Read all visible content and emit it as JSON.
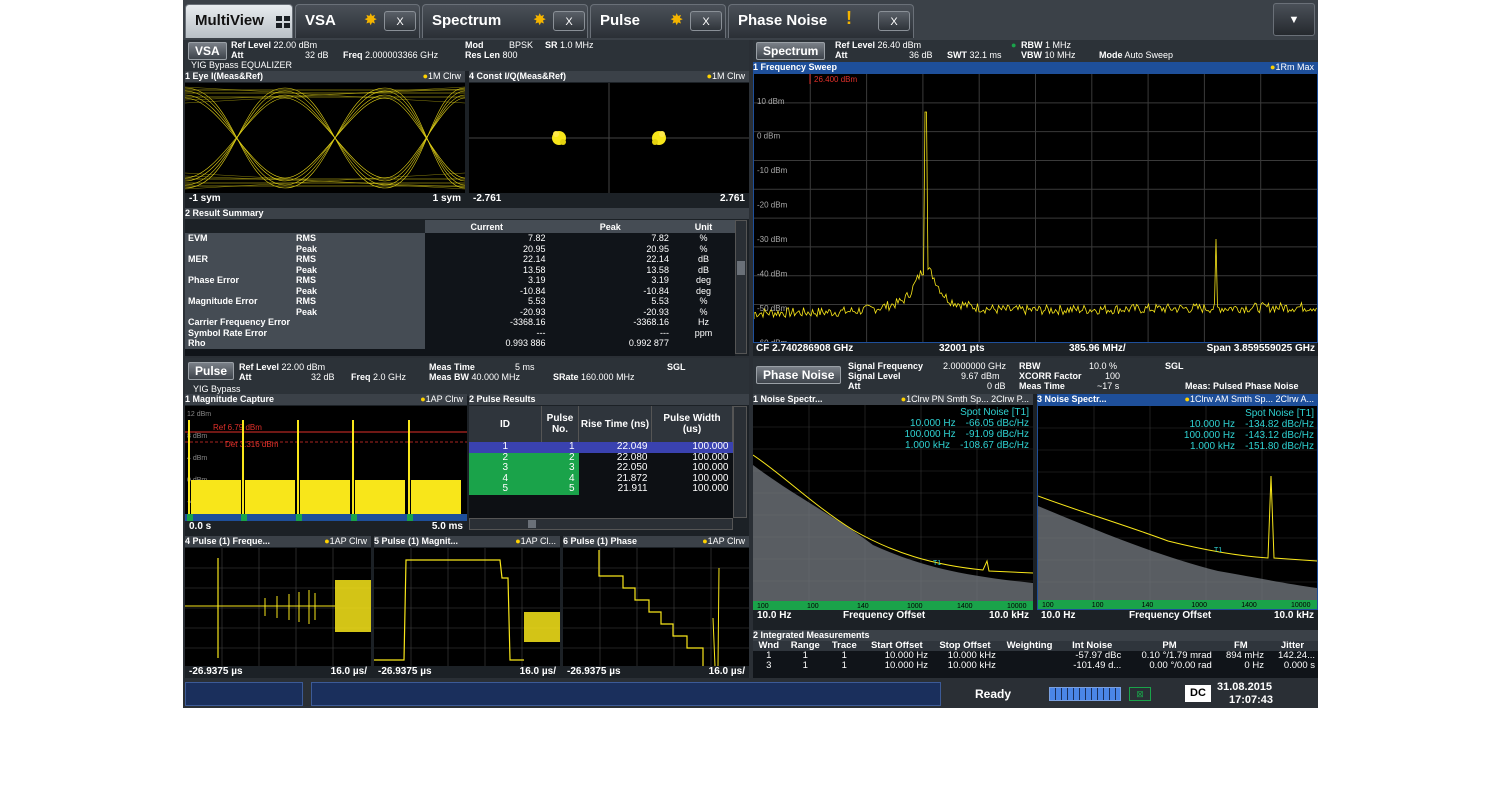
{
  "tabs": [
    {
      "label": "MultiView",
      "active": true
    },
    {
      "label": "VSA",
      "close": "X"
    },
    {
      "label": "Spectrum",
      "close": "X"
    },
    {
      "label": "Pulse",
      "close": "X"
    },
    {
      "label": "Phase Noise",
      "close": "X"
    }
  ],
  "menu_icon": "▼",
  "vsa": {
    "label": "VSA",
    "ref_level_label": "Ref Level",
    "ref_level": "22.00 dBm",
    "att_label": "Att",
    "att": "32 dB",
    "freq_label": "Freq",
    "freq": "2.000003366 GHz",
    "mod_label": "Mod",
    "mod": "BPSK",
    "sr_label": "SR",
    "sr": "1.0 MHz",
    "reslen_label": "Res Len",
    "reslen": "800",
    "bypass": "YIG Bypass EQUALIZER",
    "eye_title": "1 Eye I(Meas&Ref)",
    "eye_trace": "1M Clrw",
    "eye_xmin": "-1 sym",
    "eye_xmax": "1 sym",
    "const_title": "4 Const I/Q(Meas&Ref)",
    "const_trace": "1M Clrw",
    "const_xmin": "-2.761",
    "const_xmax": "2.761",
    "summary_title": "2 Result Summary",
    "summary_headers": [
      "Current",
      "Peak",
      "Unit"
    ],
    "summary_rows": [
      [
        "EVM",
        "RMS",
        "7.82",
        "7.82",
        "%"
      ],
      [
        "",
        "Peak",
        "20.95",
        "20.95",
        "%"
      ],
      [
        "MER",
        "RMS",
        "22.14",
        "22.14",
        "dB"
      ],
      [
        "",
        "Peak",
        "13.58",
        "13.58",
        "dB"
      ],
      [
        "Phase Error",
        "RMS",
        "3.19",
        "3.19",
        "deg"
      ],
      [
        "",
        "Peak",
        "-10.84",
        "-10.84",
        "deg"
      ],
      [
        "Magnitude Error",
        "RMS",
        "5.53",
        "5.53",
        "%"
      ],
      [
        "",
        "Peak",
        "-20.93",
        "-20.93",
        "%"
      ],
      [
        "Carrier Frequency Error",
        "",
        "-3368.16",
        "-3368.16",
        "Hz"
      ],
      [
        "Symbol Rate Error",
        "",
        "---",
        "---",
        "ppm"
      ],
      [
        "Rho",
        "",
        "0.993 886",
        "0.992 877",
        ""
      ]
    ]
  },
  "spectrum": {
    "label": "Spectrum",
    "ref_level_label": "Ref Level",
    "ref_level": "26.40 dBm",
    "att_label": "Att",
    "att": "36 dB",
    "swt_label": "SWT",
    "swt": "32.1 ms",
    "rbw_label": "RBW",
    "rbw": "1 MHz",
    "vbw_label": "VBW",
    "vbw": "10 MHz",
    "mode_label": "Mode",
    "mode": "Auto Sweep",
    "title": "1 Frequency Sweep",
    "trace": "1Rm Max",
    "marker_ref": "26.400 dBm",
    "yticks": [
      "10 dBm",
      "0 dBm",
      "-10 dBm",
      "-20 dBm",
      "-30 dBm",
      "-40 dBm",
      "-50 dBm",
      "-60 dBm"
    ],
    "cf": "CF 2.740286908 GHz",
    "pts": "32001 pts",
    "div": "385.96 MHz/",
    "span": "Span 3.859559025 GHz"
  },
  "pulse": {
    "label": "Pulse",
    "ref_level_label": "Ref Level",
    "ref_level": "22.00 dBm",
    "att_label": "Att",
    "att": "32 dB",
    "freq_label": "Freq",
    "freq": "2.0 GHz",
    "meastime_label": "Meas Time",
    "meastime": "5 ms",
    "measbw_label": "Meas BW",
    "measbw": "40.000 MHz",
    "srate_label": "SRate",
    "srate": "160.000 MHz",
    "sgl": "SGL",
    "bypass": "YIG Bypass",
    "mag_title": "1 Magnitude Capture",
    "mag_trace": "1AP Clrw",
    "mag_ref": "Ref 6.79 dBm",
    "mag_det": "Det 3.316 dBm",
    "mag_yticks": [
      "12 dBm",
      "8 dBm",
      "4 dBm",
      "0 dBm",
      "-4 dBm"
    ],
    "mag_xmin": "0.0 s",
    "mag_xmax": "5.0 ms",
    "results_title": "2 Pulse Results",
    "results_headers": [
      "ID",
      "Pulse No.",
      "Rise Time (ns)",
      "Pulse Width (us)"
    ],
    "results_rows": [
      [
        "1",
        "1",
        "22.049",
        "100.000"
      ],
      [
        "2",
        "2",
        "22.080",
        "100.000"
      ],
      [
        "3",
        "3",
        "22.050",
        "100.000"
      ],
      [
        "4",
        "4",
        "21.872",
        "100.000"
      ],
      [
        "5",
        "5",
        "21.911",
        "100.000"
      ]
    ],
    "freq_title": "4 Pulse (1) Freque...",
    "freq_trace": "1AP Clrw",
    "magn_title": "5 Pulse (1) Magnit...",
    "magn_trace": "1AP Cl...",
    "phase_title": "6 Pulse (1) Phase",
    "phase_trace": "1AP Clrw",
    "sub_xmin": "-26.9375 µs",
    "sub_xdiv": "16.0 µs/"
  },
  "phase_noise": {
    "label": "Phase Noise",
    "sigfreq_label": "Signal Frequency",
    "sigfreq": "2.0000000 GHz",
    "siglevel_label": "Signal Level",
    "siglevel": "9.67 dBm",
    "att_label": "Att",
    "att": "0 dB",
    "rbw_label": "RBW",
    "rbw": "10.0 %",
    "xcorr_label": "XCORR Factor",
    "xcorr": "100",
    "meastime_label": "Meas Time",
    "meastime": "~17 s",
    "sgl": "SGL",
    "meas": "Meas: Pulsed Phase Noise",
    "w1_title": "1 Noise Spectr...",
    "w1_trace": "1Clrw PN Smth Sp... 2Clrw P...",
    "w3_title": "3 Noise Spectr...",
    "w3_trace": "1Clrw AM Smth Sp... 2Clrw A...",
    "spot_title": "Spot Noise [T1]",
    "w1_spot": [
      [
        "10.000 Hz",
        "-66.05 dBc/Hz"
      ],
      [
        "100.000 Hz",
        "-91.09 dBc/Hz"
      ],
      [
        "1.000 kHz",
        "-108.67 dBc/Hz"
      ]
    ],
    "w3_spot": [
      [
        "10.000 Hz",
        "-134.82 dBc/Hz"
      ],
      [
        "100.000 Hz",
        "-143.12 dBc/Hz"
      ],
      [
        "1.000 kHz",
        "-151.80 dBc/Hz"
      ]
    ],
    "xmin": "10.0 Hz",
    "xlabel": "Frequency Offset",
    "xmax": "10.0 kHz",
    "axis_nums": [
      "100",
      "100",
      "140",
      "1000",
      "1400",
      "10000"
    ],
    "im_title": "2 Integrated Measurements",
    "im_headers": [
      "Wnd",
      "Range",
      "Trace",
      "Start Offset",
      "Stop Offset",
      "Weighting",
      "Int Noise",
      "PM",
      "FM",
      "Jitter"
    ],
    "im_rows": [
      [
        "1",
        "1",
        "1",
        "10.000 Hz",
        "10.000 kHz",
        "",
        "-57.97 dBc",
        "0.10 °/1.79 mrad",
        "894 mHz",
        "142.24..."
      ],
      [
        "3",
        "1",
        "1",
        "10.000 Hz",
        "10.000 kHz",
        "",
        "-101.49 d...",
        "0.00 °/0.00 rad",
        "0 Hz",
        "0.000 s"
      ]
    ]
  },
  "status": {
    "state": "Ready",
    "dc": "DC",
    "date": "31.08.2015",
    "time": "17:07:43"
  },
  "colors": {
    "trace": "#f8e61a",
    "accent": "#1e4f9a",
    "green": "#1aa34a",
    "cyan": "#2fd2d2"
  }
}
